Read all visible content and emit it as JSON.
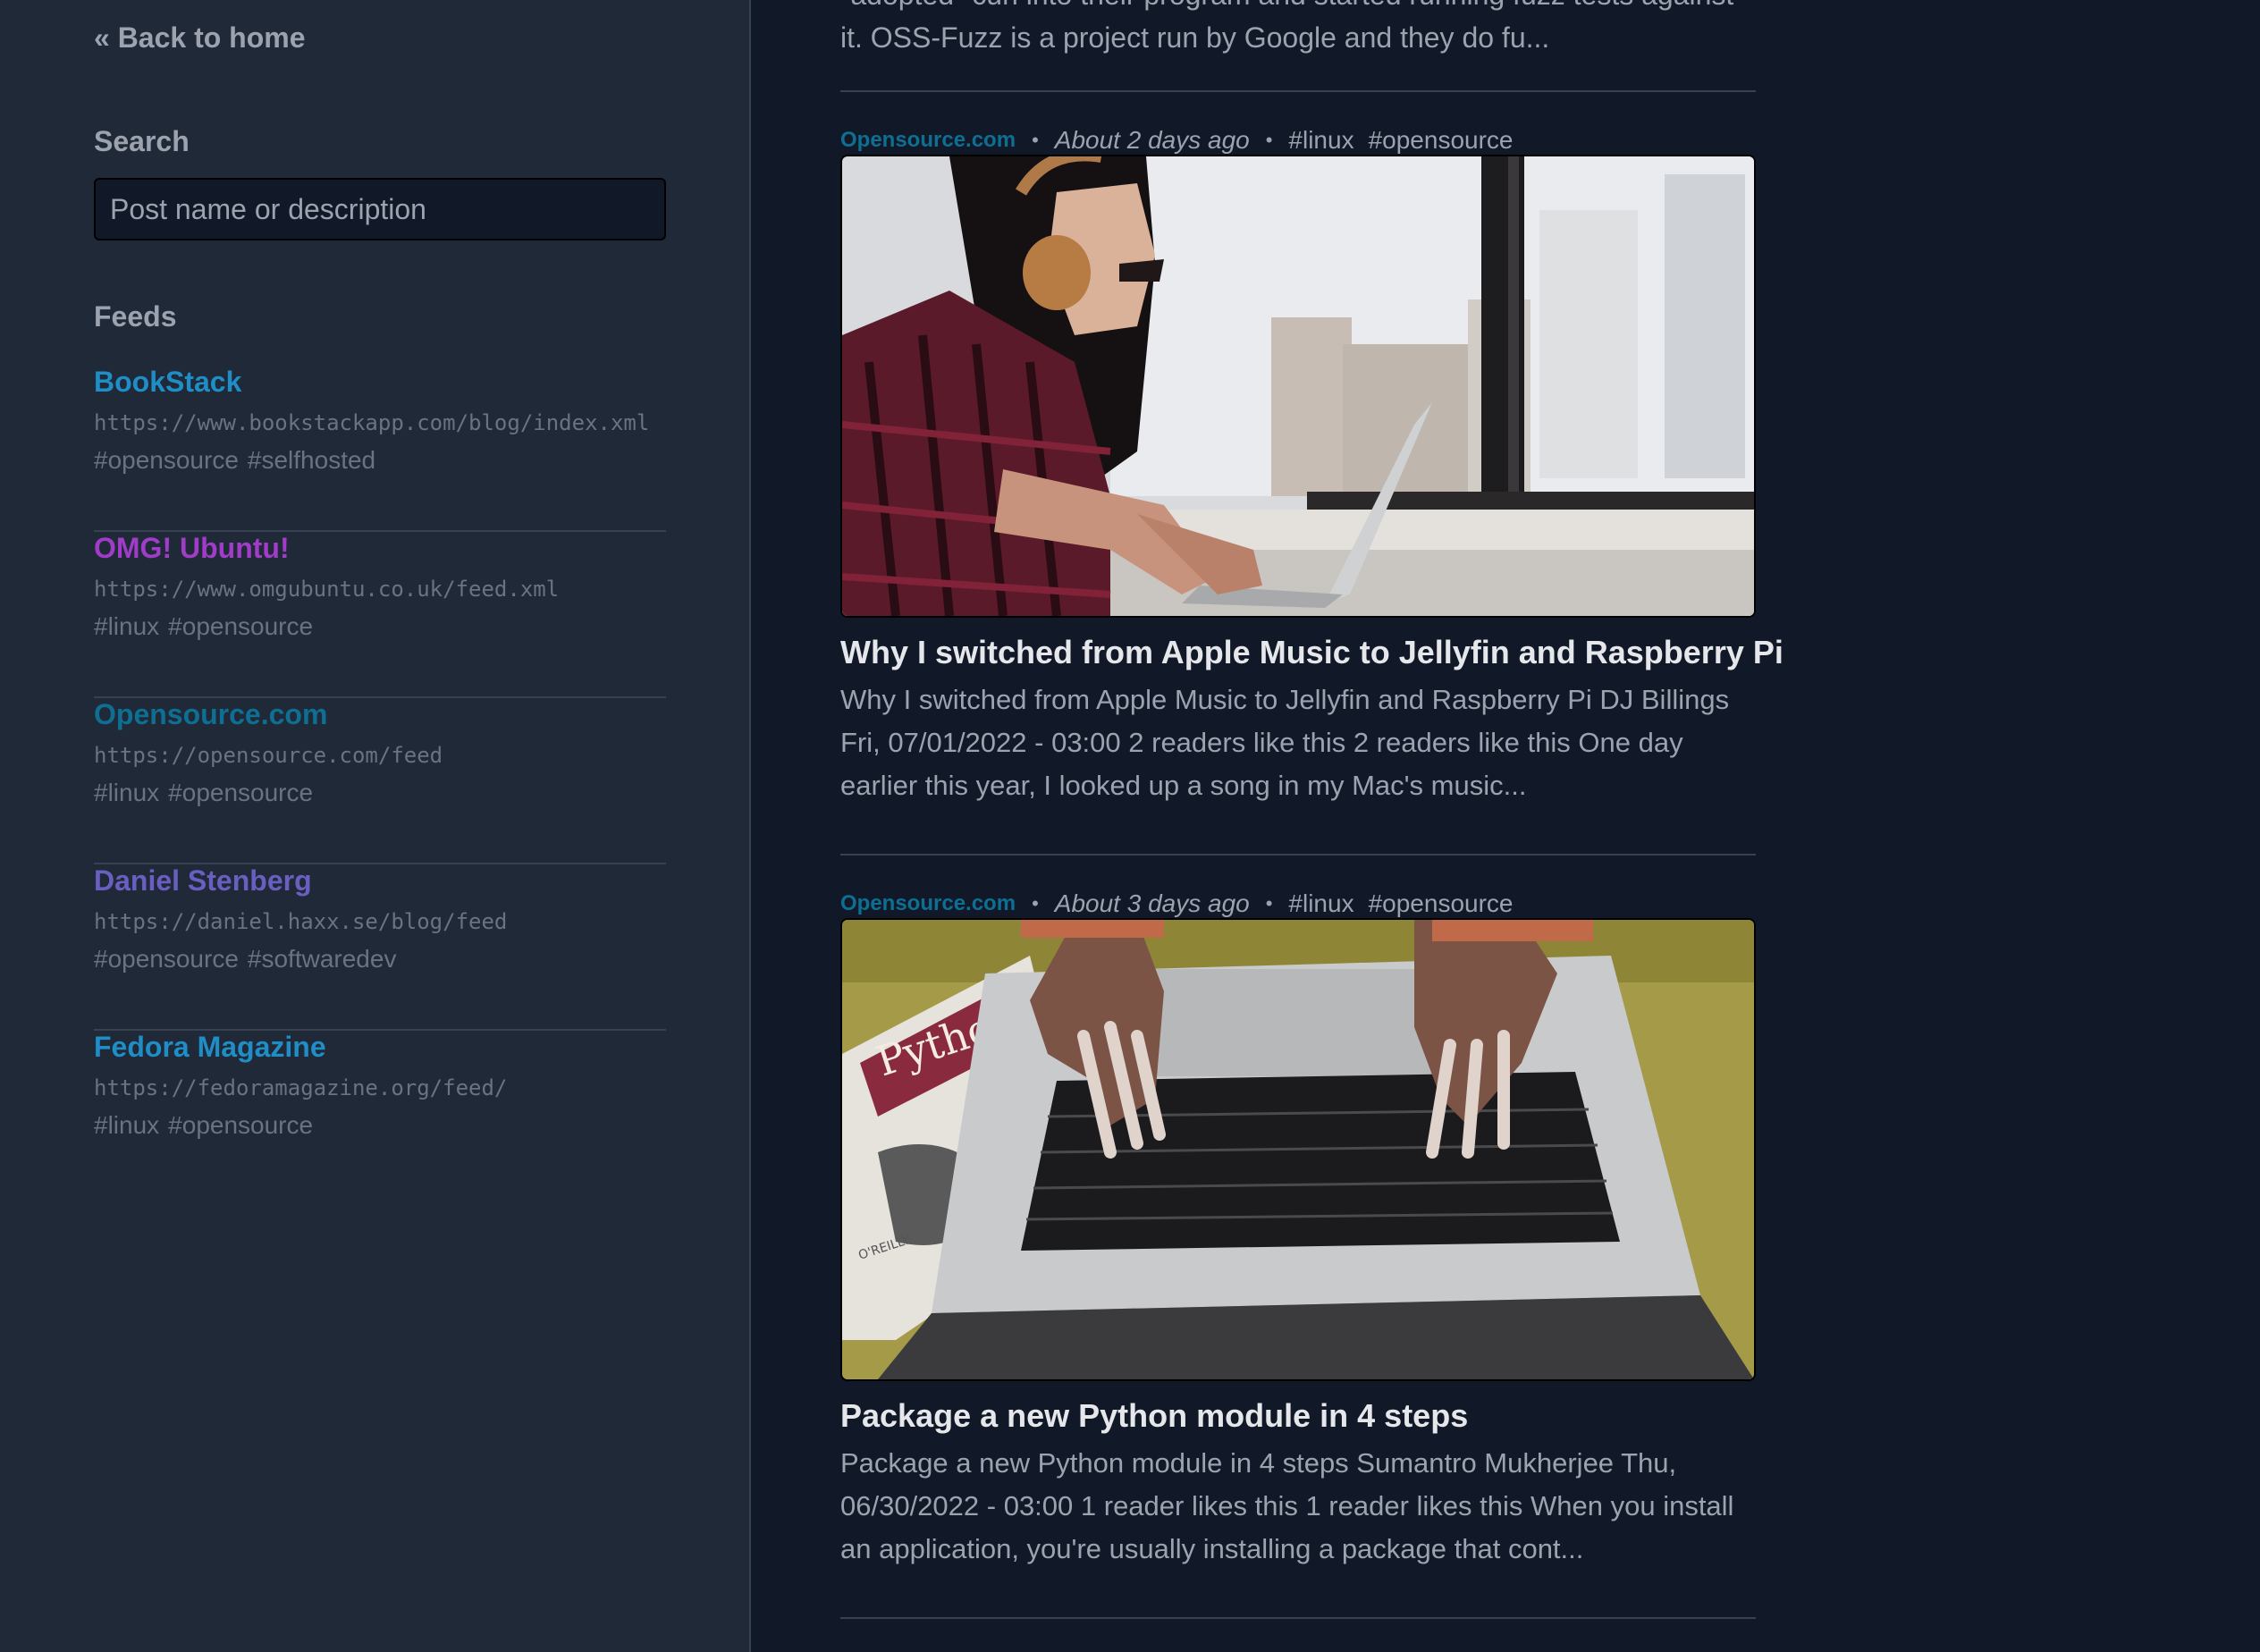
{
  "sidebar": {
    "back_link": "« Back to home",
    "search_label": "Search",
    "search_placeholder": "Post name or description",
    "feeds_label": "Feeds",
    "feeds": [
      {
        "name": "BookStack",
        "url": "https://www.bookstackapp.com/blog/index.xml",
        "tags": [
          "#opensource",
          "#selfhosted"
        ],
        "color": "#1f8dc6"
      },
      {
        "name": "OMG! Ubuntu!",
        "url": "https://www.omgubuntu.co.uk/feed.xml",
        "tags": [
          "#linux",
          "#opensource"
        ],
        "color": "#a03cc8"
      },
      {
        "name": "Opensource.com",
        "url": "https://opensource.com/feed",
        "tags": [
          "#linux",
          "#opensource"
        ],
        "color": "#0e6f93"
      },
      {
        "name": "Daniel Stenberg",
        "url": "https://daniel.haxx.se/blog/feed",
        "tags": [
          "#opensource",
          "#softwaredev"
        ],
        "color": "#6a5fc1"
      },
      {
        "name": "Fedora Magazine",
        "url": "https://fedoramagazine.org/feed/",
        "tags": [
          "#linux",
          "#opensource"
        ],
        "color": "#1f8dc6"
      }
    ]
  },
  "main": {
    "previous_excerpt": "\"adopted\" curl into their program and started running fuzz tests against it. OSS-Fuzz is a project run by Google and they do fu...",
    "posts": [
      {
        "source": "Opensource.com",
        "time": "About 2 days ago",
        "tags": [
          "#linux",
          "#opensource"
        ],
        "image_alt": "woman-with-headphones-using-laptop",
        "title": "Why I switched from Apple Music to Jellyfin and Raspberry Pi",
        "excerpt": "Why I switched from Apple Music to Jellyfin and Raspberry Pi DJ Billings Fri, 07/01/2022 - 03:00 2 readers like this 2 readers like this One day earlier this year, I looked up a song in my Mac's music..."
      },
      {
        "source": "Opensource.com",
        "time": "About 3 days ago",
        "tags": [
          "#linux",
          "#opensource"
        ],
        "image_alt": "hands-typing-on-laptop-with-python-book",
        "image_book_text": "Python",
        "image_book_publisher": "O'REILLY",
        "title": "Package a new Python module in 4 steps",
        "excerpt": "Package a new Python module in 4 steps Sumantro Mukherjee Thu, 06/30/2022 - 03:00 1 reader likes this 1 reader likes this When you install an application, you're usually installing a package that cont..."
      }
    ]
  }
}
